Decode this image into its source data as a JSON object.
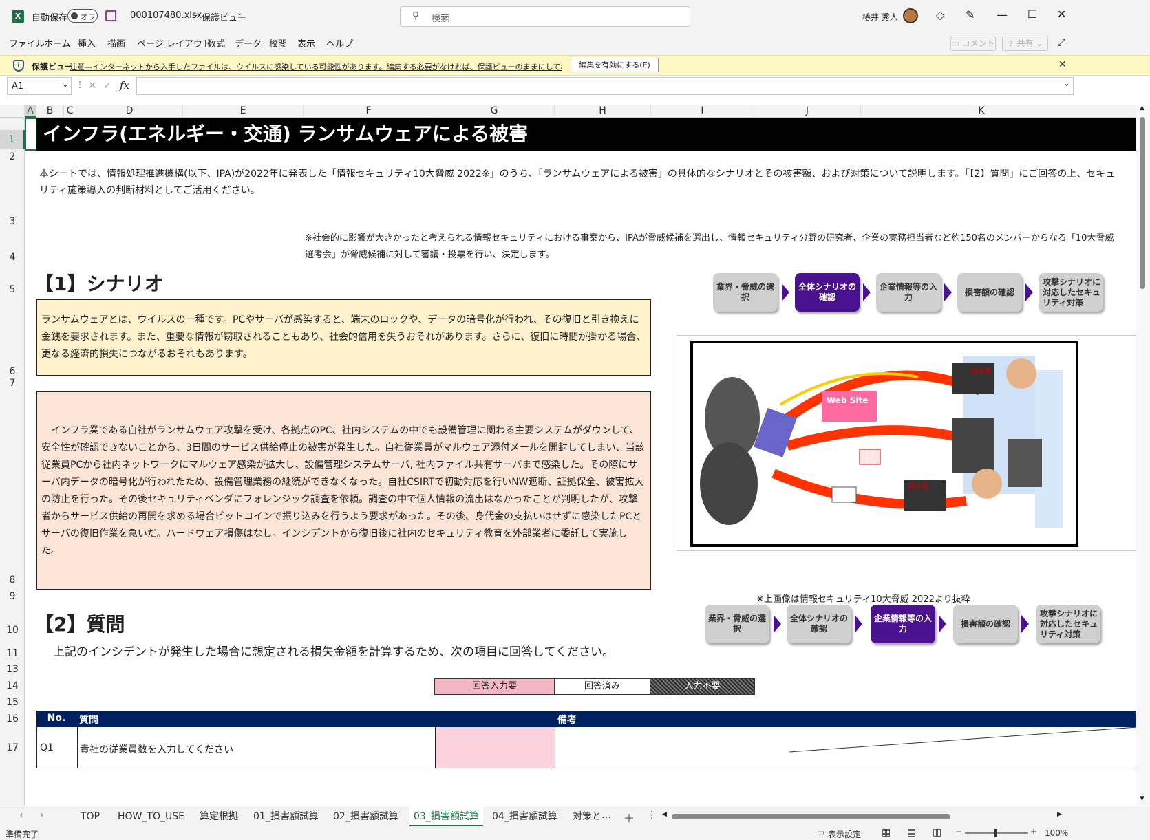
{
  "app": {
    "autosave_label": "自動保存",
    "autosave_state": "オフ",
    "filename": "000107480.xlsx",
    "separator": "-",
    "view_mode": "保護ビュー",
    "search_placeholder": "検索",
    "user_name": "椿井 秀人",
    "accent_color": "#1e7145"
  },
  "ribbon": {
    "tabs": [
      "ファイル",
      "ホーム",
      "挿入",
      "描画",
      "ページ レイアウト",
      "数式",
      "データ",
      "校閲",
      "表示",
      "ヘルプ"
    ],
    "comment_label": "コメント",
    "share_label": "共有"
  },
  "protected_view": {
    "title": "保護ビュー",
    "message": "注意—インターネットから入手したファイルは、ウイルスに感染している可能性があります。編集する必要がなければ、保護ビューのままにしておくことをお勧めします。",
    "enable_button": "編集を有効にする(E)"
  },
  "formula_bar": {
    "name_box": "A1",
    "fx": "fx",
    "content": ""
  },
  "columns": [
    "A",
    "B",
    "C",
    "D",
    "E",
    "F",
    "G",
    "H",
    "I",
    "J",
    "K"
  ],
  "rows": [
    "1",
    "2",
    "3",
    "4",
    "5",
    "6",
    "7",
    "8",
    "9",
    "10",
    "11",
    "13",
    "14",
    "15",
    "16",
    "17"
  ],
  "sheet": {
    "title": "インフラ(エネルギー・交通) ランサムウェアによる被害",
    "intro": "本シートでは、情報処理推進機構(以下、IPA)が2022年に発表した「情報セキュリティ10大脅威 2022※」のうち、「ランサムウェアによる被害」の具体的なシナリオとその被害額、および対策について説明します。「【2】質問」にご回答の上、セキュリティ施策導入の判断材料としてご活用ください。",
    "note": "※社会的に影響が大きかったと考えられる情報セキュリティにおける事案から、IPAが脅威候補を選出し、情報セキュリティ分野の研究者、企業の実務担当者など約150名のメンバーからなる「10大脅威選考会」が脅威候補に対して審議・投票を行い、決定します。",
    "section1": "【1】シナリオ",
    "definition": "ランサムウェアとは、ウイルスの一種です。PCやサーバが感染すると、端末のロックや、データの暗号化が行われ、その復旧と引き換えに金銭を要求されます。また、重要な情報が窃取されることもあり、社会的信用を失うおそれがあります。さらに、復旧に時間が掛かる場合、更なる経済的損失につながるおそれもあります。",
    "scenario": "インフラ業である自社がランサムウェア攻撃を受け、各拠点のPC、社内システムの中でも設備管理に関わる主要システムがダウンして、安全性が確認できないことから、3日間のサービス供給停止の被害が発生した。自社従業員がマルウェア添付メールを開封してしまい、当該従業員PCから社内ネットワークにマルウェア感染が拡大し、設備管理システムサーバ, 社内ファイル共有サーバまで感染した。その際にサーバ内データの暗号化が行われたため、設備管理業務の継続ができなくなった。自社CSIRTで初動対応を行いNW遮断、証拠保全、被害拡大の防止を行った。その後セキュリティベンダにフォレンジック調査を依頼。調査の中で個人情報の流出はなかったことが判明したが、攻撃者からサービス供給の再開を求める場合ビットコインで振り込みを行うよう要求があった。その後、身代金の支払いはせずに感染したPCとサーバの復旧作業を急いだ。ハードウェア損傷はなし。インシデントから復旧後に社内のセキュリティ教育を外部業者に委託して実施した。",
    "image_credit": "※上画像は情報セキュリティ10大脅威 2022より抜粋",
    "image_label_website": "Web Site",
    "image_label_ransom": "請求書",
    "section2": "【2】質問",
    "question_intro": "上記のインシデントが発生した場合に想定される損失金額を計算するため、次の項目に回答してください。",
    "legend": [
      "回答入力要",
      "回答済み",
      "入力不要"
    ],
    "table_headers": {
      "no": "No.",
      "question": "質問",
      "remarks": "備考"
    },
    "rows": [
      {
        "no": "Q1",
        "question": "貴社の従業員数を入力してください"
      }
    ]
  },
  "steps_top": [
    "業界・脅威の選択",
    "全体シナリオの確認",
    "企業情報等の入力",
    "損害額の確認",
    "攻撃シナリオに対応したセキュリティ対策"
  ],
  "steps_top_active": 1,
  "steps_bottom_active": 2,
  "sheet_tabs": [
    "TOP",
    "HOW_TO_USE",
    "算定根拠",
    "01_損害額試算",
    "02_損害額試算",
    "03_損害額試算",
    "04_損害額試算",
    "対策と"
  ],
  "active_sheet": 5,
  "status": {
    "ready": "準備完了",
    "display_settings": "表示設定",
    "zoom": "100%"
  },
  "colors": {
    "title_bg": "#000000",
    "definition_bg": "#fff2cc",
    "scenario_bg": "#fce4d6",
    "step_active": "#4a128f",
    "table_header": "#002060",
    "required_input": "#f4b6c2"
  }
}
